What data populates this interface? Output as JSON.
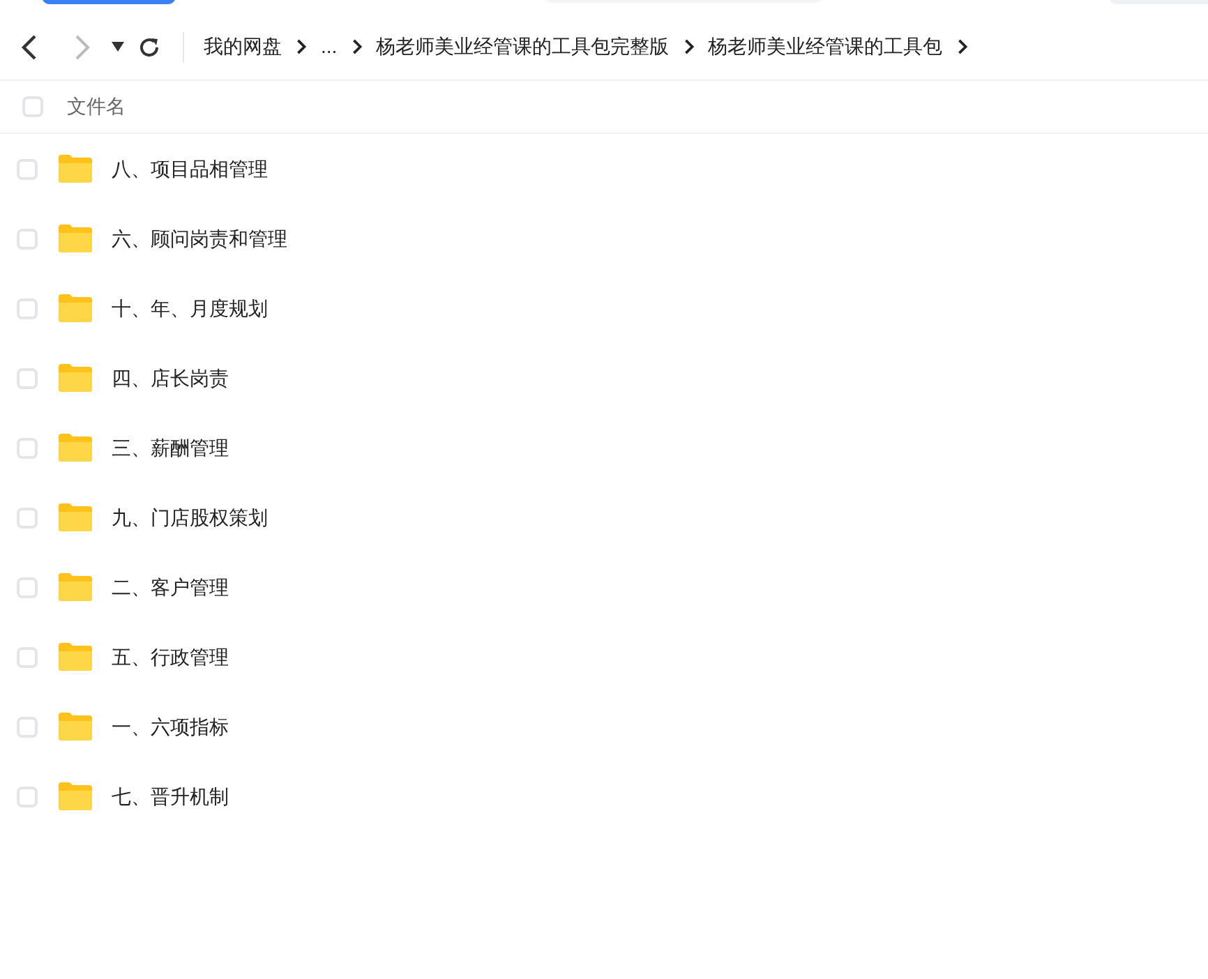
{
  "breadcrumb": [
    {
      "label": "我的网盘"
    },
    {
      "label": "..."
    },
    {
      "label": "杨老师美业经管课的工具包完整版"
    },
    {
      "label": "杨老师美业经管课的工具包"
    }
  ],
  "header": {
    "checked": false,
    "column": "文件名"
  },
  "files": [
    {
      "name": "八、项目品相管理",
      "checked": false
    },
    {
      "name": "六、顾问岗责和管理",
      "checked": false
    },
    {
      "name": "十、年、月度规划",
      "checked": false
    },
    {
      "name": "四、店长岗责",
      "checked": false
    },
    {
      "name": "三、薪酬管理",
      "checked": false
    },
    {
      "name": "九、门店股权策划",
      "checked": false
    },
    {
      "name": "二、客户管理",
      "checked": false
    },
    {
      "name": "五、行政管理",
      "checked": false
    },
    {
      "name": "一、六项指标",
      "checked": false
    },
    {
      "name": "七、晋升机制",
      "checked": false
    }
  ]
}
